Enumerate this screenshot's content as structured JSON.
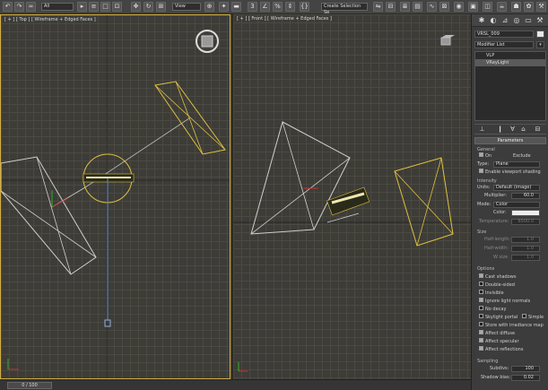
{
  "toolbar": {
    "selection_filter": "All",
    "view_coordinate": "View",
    "named_selection": "Create Selection Se"
  },
  "viewports": {
    "left_label": "[ + ] [ Top ] [ Wireframe + Edged Faces ]",
    "right_label": "[ + ] [ Front ] [ Wireframe + Edged Faces ]"
  },
  "panel": {
    "object_name": "VRSL_009",
    "modifier_list": "Modifier List",
    "stack": [
      "VLP",
      "VRayLight"
    ],
    "rollout_title": "Parameters",
    "general": {
      "header": "General",
      "on_label": "On",
      "exclude_label": "Exclude",
      "type_label": "Type:",
      "type_value": "Plane",
      "viewport_shading": "Enable viewport shading"
    },
    "intensity": {
      "header": "Intensity",
      "units_label": "Units:",
      "units_value": "Default (image)",
      "multiplier_label": "Multiplier:",
      "multiplier_value": "60.0",
      "mode_label": "Mode:",
      "mode_value": "Color",
      "color_label": "Color:",
      "temperature_label": "Temperature:",
      "temperature_value": "6500.0"
    },
    "size": {
      "header": "Size",
      "half_length_label": "Half-length:",
      "half_length_value": "1.0",
      "half_width_label": "Half-width:",
      "half_width_value": "1.0",
      "w_size_label": "W size",
      "w_size_value": "1.0"
    },
    "options": {
      "header": "Options",
      "items": [
        {
          "label": "Cast shadows",
          "checked": true
        },
        {
          "label": "Double-sided",
          "checked": false
        },
        {
          "label": "Invisible",
          "checked": false
        },
        {
          "label": "Ignore light normals",
          "checked": true
        },
        {
          "label": "No decay",
          "checked": false
        },
        {
          "label": "Skylight portal",
          "checked": false
        },
        {
          "label": "Store with irradiance map",
          "checked": false
        },
        {
          "label": "Affect diffuse",
          "checked": true
        },
        {
          "label": "Affect specular",
          "checked": true
        },
        {
          "label": "Affect reflections",
          "checked": true
        }
      ],
      "simple_label": "Simple"
    },
    "sampling": {
      "header": "Sampling",
      "subdivs_label": "Subdivs:",
      "subdivs_value": "100",
      "shadow_bias_label": "Shadow bias:",
      "shadow_bias_value": "0.02"
    }
  },
  "timeline": {
    "frame": "0 / 100"
  },
  "colors": {
    "grid_bg": "#3d3c37",
    "active_border": "#d4b043",
    "selected_wire": "#e0c040",
    "light_wire": "#c8c8c8",
    "vertical_line": "#5a8fd0"
  }
}
